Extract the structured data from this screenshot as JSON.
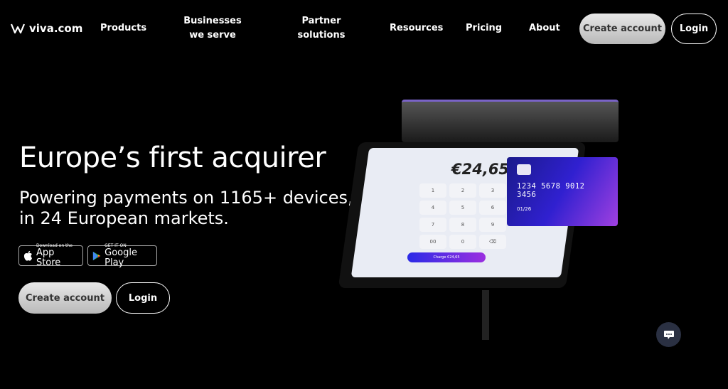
{
  "nav": {
    "logo": "viva.com",
    "items": [
      "Products",
      "Businesses we serve",
      "Partner solutions",
      "Resources",
      "Pricing",
      "About"
    ],
    "create_account": "Create account",
    "login": "Login"
  },
  "hero": {
    "title": "Europe’s first acquirer",
    "subtitle_line1": "Powering payments on 1165+ devices,",
    "subtitle_line2": "in 24 European markets.",
    "app_store": {
      "small": "Download on the",
      "big": "App Store"
    },
    "google_play": {
      "small": "GET IT ON",
      "big": "Google Play"
    },
    "create_account": "Create account",
    "login": "Login"
  },
  "device": {
    "amount": "€24,65",
    "keys": [
      "1",
      "2",
      "3",
      "4",
      "5",
      "6",
      "7",
      "8",
      "9",
      "00",
      "0",
      "⌫"
    ],
    "charge": "Charge €24,65",
    "card_number": "1234  5678  9012  3456",
    "card_expiry": "01/26"
  },
  "colors": {
    "background": "#000000",
    "card_gradient_start": "#1a1a8a",
    "card_gradient_end": "#a040e0"
  }
}
